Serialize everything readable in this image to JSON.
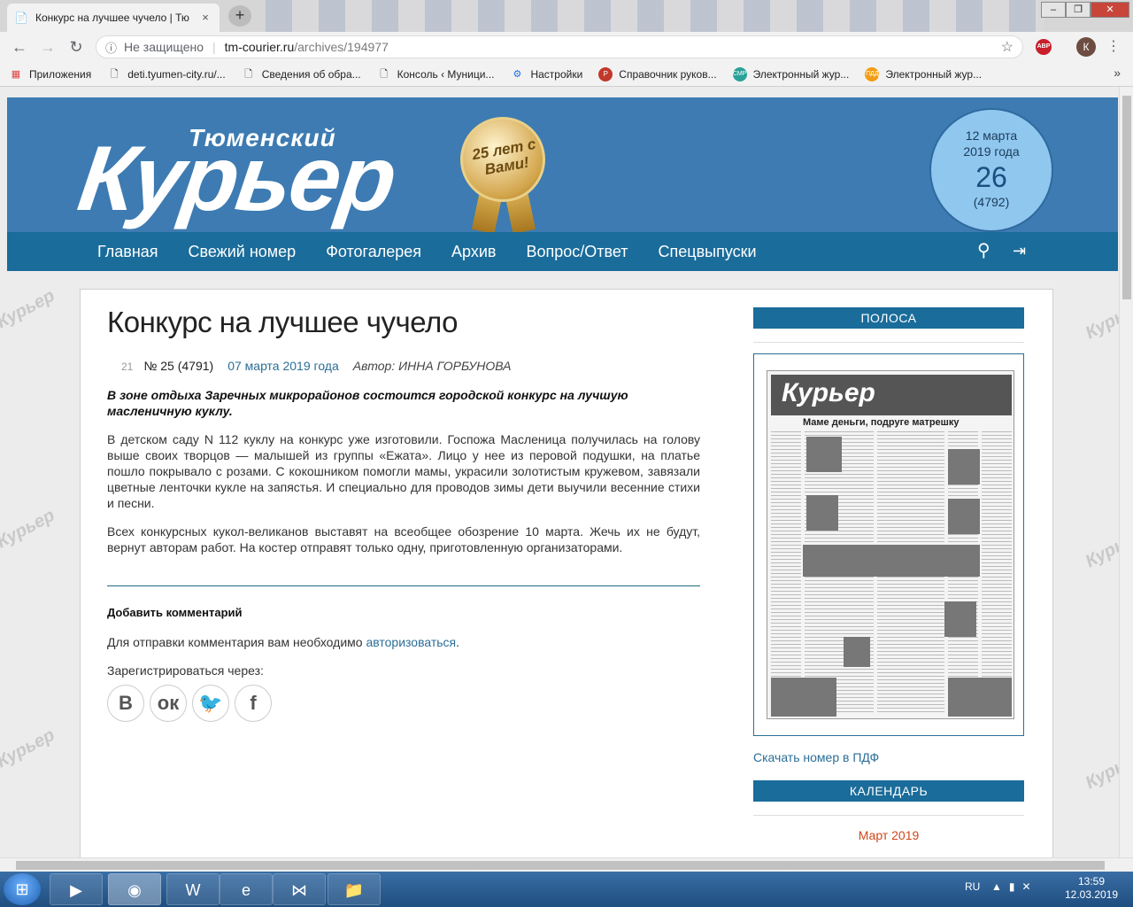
{
  "browser": {
    "tab_title": "Конкурс на лучшее чучело | Тю",
    "tab_close": "×",
    "new_tab": "+",
    "address": {
      "security": "Не защищено",
      "host": "tm-courier.ru",
      "path": "/archives/194977"
    },
    "extension_badge": "ABP",
    "profile_initial": "К",
    "bookmarks": [
      {
        "label": "Приложения",
        "icon": "apps-grid-icon"
      },
      {
        "label": "deti.tyumen-city.ru/...",
        "icon": "page-icon"
      },
      {
        "label": "Сведения об обра...",
        "icon": "page-icon"
      },
      {
        "label": "Консоль ‹ Муници...",
        "icon": "page-icon"
      },
      {
        "label": "Настройки",
        "icon": "gear-icon"
      },
      {
        "label": "Справочник руков...",
        "icon": "pdu-icon"
      },
      {
        "label": "Электронный жур...",
        "icon": "smr-icon"
      },
      {
        "label": "Электронный жур...",
        "icon": "pdd-icon"
      }
    ],
    "bookmarks_more": "»"
  },
  "site": {
    "logo_small": "Тюменский",
    "logo_big": "Курьер",
    "medal_text": "25 лет с Вами!",
    "date": {
      "line": "12 марта",
      "year": "2019  года",
      "issue_day": "26",
      "issue_total": "(4792)"
    },
    "nav": [
      "Главная",
      "Свежий номер",
      "Фотогалерея",
      "Архив",
      "Вопрос/Ответ",
      "Спецвыпуски"
    ],
    "watermark": "Курьер"
  },
  "article": {
    "title": "Конкурс на лучшее чучело",
    "views": "21",
    "issue": "№ 25 (4791)",
    "date": "07 марта 2019 года",
    "author": "Автор: ИННА ГОРБУНОВА",
    "lead": "В зоне отдыха Заречных микрорайонов состоится городской конкурс на лучшую масленичную куклу.",
    "paragraphs": [
      "В детском саду N 112 куклу на конкурс уже изготовили. Госпожа Масленица получилась на голову выше своих творцов — малышей из группы «Ежата». Лицо у нее из перовой подушки, на платье пошло покрывало с розами. С кокошником помогли мамы, украсили золотистым кружевом, завязали цветные ленточки кукле на запястья. И специально для проводов зимы дети выучили весенние стихи и песни.",
      "Всех конкурсных кукол-великанов выставят на всеобщее обозрение 10 марта. Жечь их не будут, вернут авторам работ. На костер отправят только одну, приготовленную организаторами."
    ],
    "comment_heading": "Добавить комментарий",
    "comment_note": "Для отправки комментария вам необходимо ",
    "comment_link": "авторизоваться",
    "comment_end": ".",
    "register_via": "Зарегистрироваться через:",
    "social": [
      {
        "glyph": "В",
        "icon": "vk-icon"
      },
      {
        "glyph": "ок",
        "icon": "odnoklassniki-icon"
      },
      {
        "glyph": "🐦",
        "icon": "twitter-icon"
      },
      {
        "glyph": "f",
        "icon": "facebook-icon"
      }
    ]
  },
  "sidebar": {
    "page_heading": "ПОЛОСА",
    "newspaper_logo": "Курьер",
    "newspaper_headline": "Маме деньги, подруге матрешку",
    "download": "Скачать номер в ПДФ",
    "calendar_heading": "КАЛЕНДАРЬ",
    "calendar_month": "Март 2019"
  },
  "taskbar": {
    "lang": "RU",
    "time": "13:59",
    "date": "12.03.2019"
  }
}
